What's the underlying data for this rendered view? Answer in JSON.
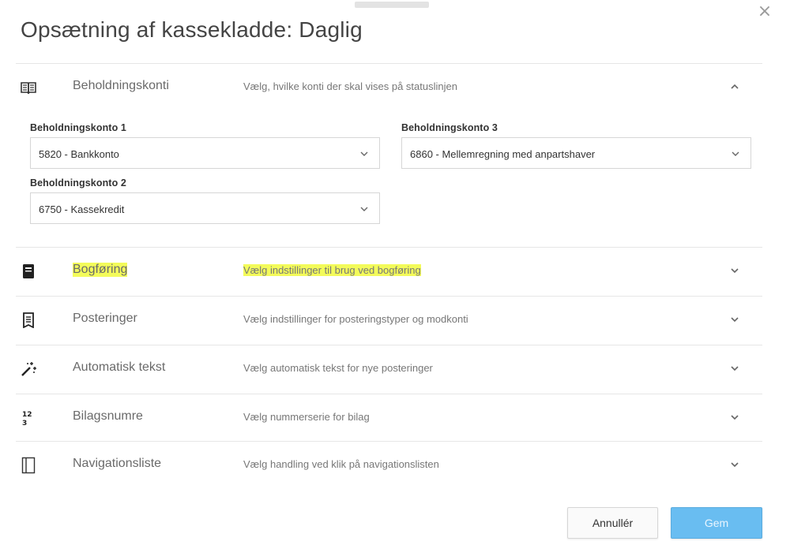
{
  "dialog": {
    "title": "Opsætning af kassekladde: Daglig",
    "close_symbol": "×"
  },
  "sections": [
    {
      "id": "beholdningskonti",
      "title": "Beholdningskonti",
      "description": "Vælg, hvilke konti der skal vises på statuslinjen",
      "icon": "book-open-icon",
      "expanded": true,
      "fields": [
        {
          "label": "Beholdningskonto 1",
          "value": "5820 - Bankkonto"
        },
        {
          "label": "Beholdningskonto 3",
          "value": "6860 - Mellemregning med anpartshaver"
        },
        {
          "label": "Beholdningskonto 2",
          "value": "6750 - Kassekredit"
        }
      ]
    },
    {
      "id": "bogfoering",
      "title": "Bogføring",
      "description": "Vælg indstillinger til brug ved bogføring",
      "icon": "ledger-icon",
      "expanded": false,
      "highlighted": true,
      "highlight_color": "#f3fb5a"
    },
    {
      "id": "posteringer",
      "title": "Posteringer",
      "description": "Vælg indstillinger for posteringstyper og modkonti",
      "icon": "document-icon",
      "expanded": false
    },
    {
      "id": "automatisk-tekst",
      "title": "Automatisk tekst",
      "description": "Vælg automatisk tekst for nye posteringer",
      "icon": "magic-wand-icon",
      "expanded": false
    },
    {
      "id": "bilagsnumre",
      "title": "Bilagsnumre",
      "description": "Vælg nummerserie for bilag",
      "icon": "number-sequence-icon",
      "icon_text": "12 3",
      "expanded": false
    },
    {
      "id": "navigationsliste",
      "title": "Navigationsliste",
      "description": "Vælg handling ved klik på navigationslisten",
      "icon": "panel-icon",
      "expanded": false
    }
  ],
  "footer": {
    "cancel_label": "Annullér",
    "save_label": "Gem"
  },
  "colors": {
    "primary": "#69bdf1",
    "highlight": "#f3fb5a",
    "border": "#e6e6e6"
  }
}
